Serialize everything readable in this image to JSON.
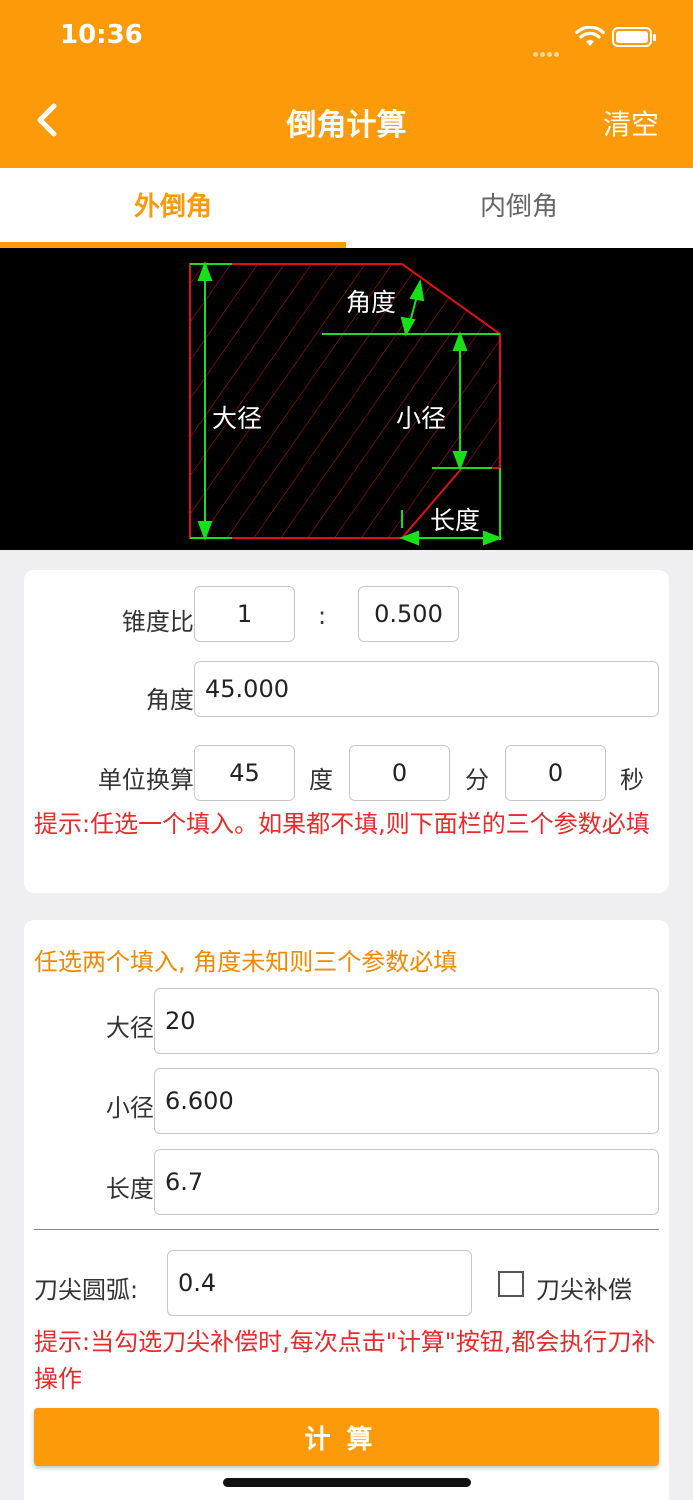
{
  "status_bar": {
    "time": "10:36"
  },
  "nav": {
    "title": "倒角计算",
    "clear_label": "清空"
  },
  "tabs": [
    {
      "label": "外倒角",
      "active": true
    },
    {
      "label": "内倒角",
      "active": false
    }
  ],
  "diagram": {
    "labels": {
      "angle": "角度",
      "major_diameter": "大径",
      "minor_diameter": "小径",
      "length": "长度"
    }
  },
  "taper_section": {
    "taper_ratio_label": "锥度比:",
    "taper_ratio_left": "1",
    "taper_separator": ":",
    "taper_ratio_right": "0.500",
    "angle_label": "角度:",
    "angle_value": "45.000",
    "unit_conversion_label": "单位换算:",
    "degrees_value": "45",
    "degrees_unit": "度",
    "minutes_value": "0",
    "minutes_unit": "分",
    "seconds_value": "0",
    "seconds_unit": "秒",
    "hint": "提示:任选一个填入。如果都不填,则下面栏的三个参数必填"
  },
  "dimension_section": {
    "hint": "任选两个填入, 角度未知则三个参数必填",
    "major_label": "大径:",
    "major_value": "20",
    "minor_label": "小径:",
    "minor_value": "6.600",
    "length_label": "长度:",
    "length_value": "6.7",
    "tip_radius_label": "刀尖圆弧:",
    "tip_radius_value": "0.4",
    "tip_compensation_label": "刀尖补偿",
    "tip_compensation_checked": false,
    "hint2": "提示:当勾选刀尖补偿时,每次点击\"计算\"按钮,都会执行刀补操作",
    "calculate_label": "计算"
  },
  "colors": {
    "accent": "#fd9a09",
    "hint_red": "#e82a2a",
    "hint_orange": "#f08a00",
    "diagram_outline": "#e01010",
    "diagram_dimension": "#18e018"
  }
}
